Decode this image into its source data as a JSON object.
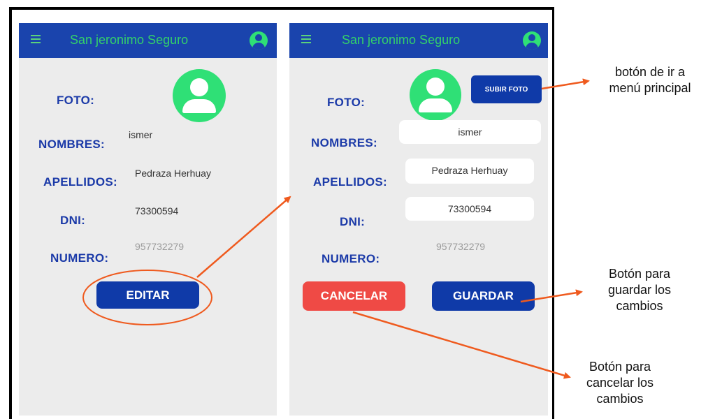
{
  "app": {
    "title": "San jeronimo Seguro"
  },
  "labels": {
    "foto": "FOTO:",
    "nombres": "NOMBRES:",
    "apellidos": "APELLIDOS:",
    "dni": "DNI:",
    "numero": "NUMERO:"
  },
  "profile": {
    "nombres": "ismer",
    "apellidos": "Pedraza Herhuay",
    "dni": "73300594",
    "numero": "957732279"
  },
  "buttons": {
    "editar": "EDITAR",
    "subir_foto": "SUBIR FOTO",
    "cancelar": "CANCELAR",
    "guardar": "GUARDAR"
  },
  "annotations": {
    "menu": [
      "botón de ir a",
      "menú principal"
    ],
    "guardar": [
      "Botón para",
      "guardar los",
      "cambios"
    ],
    "cancelar": [
      "Botón para",
      "cancelar los",
      "cambios"
    ]
  },
  "colors": {
    "appbar": "#1a44ad",
    "title": "#33d06a",
    "avatar": "#2fe076",
    "label": "#1b3aa8",
    "save": "#0f3aa8",
    "cancel": "#ef4a45",
    "arrow": "#ef5a1e"
  },
  "icons": {
    "menu": "hamburger-menu-icon",
    "account": "account-circle-icon",
    "photo": "user-avatar-icon"
  }
}
